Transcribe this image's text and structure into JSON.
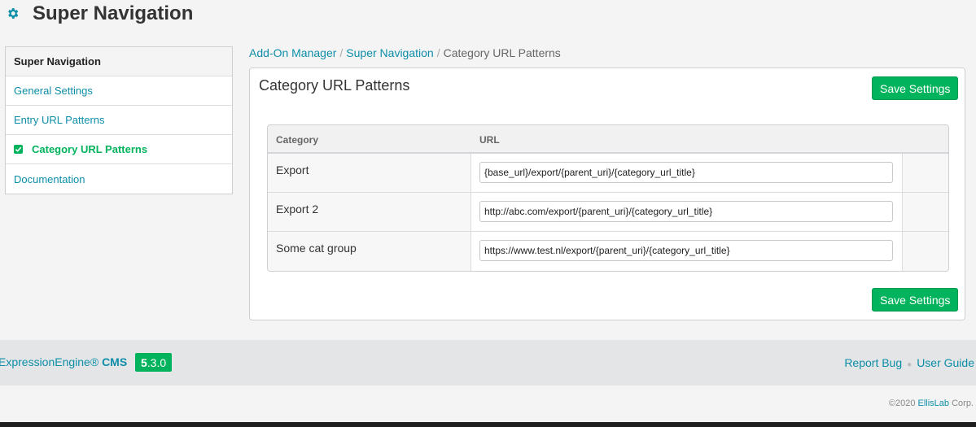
{
  "app": {
    "title": "Super Navigation",
    "icon": "gear-icon"
  },
  "sidebar": {
    "items": [
      {
        "label": "Super Navigation",
        "kind": "header"
      },
      {
        "label": "General Settings"
      },
      {
        "label": "Entry URL Patterns"
      },
      {
        "label": "Category URL Patterns",
        "active": true
      },
      {
        "label": "Documentation"
      }
    ]
  },
  "breadcrumb": {
    "items": [
      "Add-On Manager",
      "Super Navigation"
    ],
    "separator": "/",
    "current": "Category URL Patterns"
  },
  "panel": {
    "title": "Category URL Patterns",
    "save_label": "Save Settings",
    "table": {
      "headers": [
        "Category",
        "URL"
      ],
      "rows": [
        {
          "category": "Export",
          "url": "{base_url}/export/{parent_uri}/{category_url_title}"
        },
        {
          "category": "Export 2",
          "url": "http://abc.com/export/{parent_uri}/{category_url_title}"
        },
        {
          "category": "Some cat group",
          "url": "https://www.test.nl/export/{parent_uri}/{category_url_title}"
        }
      ]
    }
  },
  "footer": {
    "product": "ExpressionEngine®",
    "product_suffix": "CMS",
    "version_major": "5",
    "version_rest": ".3.0",
    "links": [
      "Report Bug",
      "User Guide"
    ],
    "copyright": "©2020",
    "company": "EllisLab",
    "company_suffix": "Corp."
  },
  "colors": {
    "accent": "#00b35c",
    "link": "#0d8ea8"
  }
}
